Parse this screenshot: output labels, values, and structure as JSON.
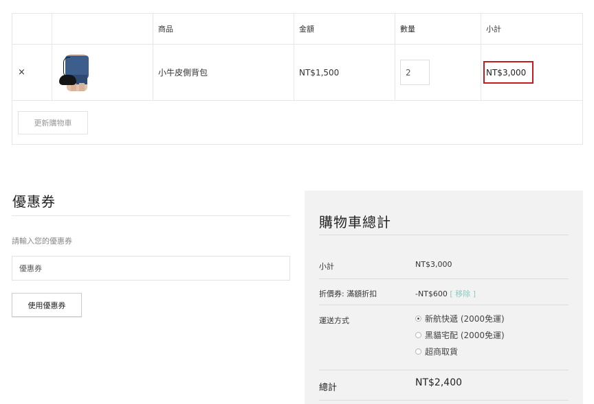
{
  "cart": {
    "columns": {
      "product": "商品",
      "price": "金額",
      "quantity": "數量",
      "subtotal": "小計"
    },
    "items": [
      {
        "remove": "×",
        "thumbnail": "handbag-photo",
        "name": "小牛皮側背包",
        "price": "NT$1,500",
        "quantity": "2",
        "subtotal": "NT$3,000"
      }
    ],
    "update_button": "更新購物車",
    "highlight_color": "#c41a1f"
  },
  "coupon": {
    "title": "優惠券",
    "prompt": "請輸入您的優惠券",
    "placeholder": "優惠券",
    "apply_button": "使用優惠券"
  },
  "totals": {
    "title": "購物車總計",
    "subtotal_label": "小計",
    "subtotal_value": "NT$3,000",
    "coupon_label": "折價券: 滿額折扣",
    "coupon_value": "-NT$600",
    "coupon_remove": "[ 移除 ]",
    "shipping_label": "運送方式",
    "shipping_options": [
      {
        "label": "新航快遞 (2000免運)",
        "selected": true
      },
      {
        "label": "黑貓宅配 (2000免運)",
        "selected": false
      },
      {
        "label": "超商取貨",
        "selected": false
      }
    ],
    "total_label": "總計",
    "total_value": "NT$2,400",
    "panel_color": "#f2f2f2",
    "link_color": "#8cc8c0"
  }
}
